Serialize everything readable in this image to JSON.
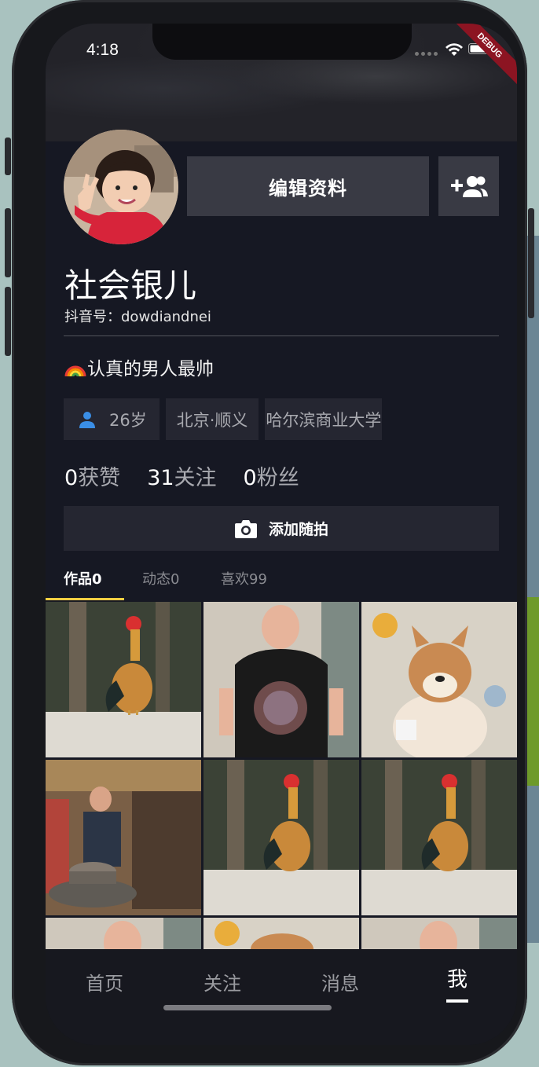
{
  "status_bar": {
    "time": "4:18",
    "debug_label": "DEBUG"
  },
  "profile": {
    "edit_button_label": "编辑资料",
    "nickname": "社会银儿",
    "douyin_id": "抖音号：dowdiandnei",
    "signature": "认真的男人最帅",
    "tags": {
      "age": "26岁",
      "location": "北京·顺义",
      "school": "哈尔滨商业大学"
    },
    "stats": [
      {
        "num": "0",
        "label": "获赞"
      },
      {
        "num": "31",
        "label": "关注"
      },
      {
        "num": "0",
        "label": "粉丝"
      }
    ],
    "add_photo_label": "添加随拍"
  },
  "tabs": [
    {
      "label": "作品0",
      "active": true
    },
    {
      "label": "动态0",
      "active": false
    },
    {
      "label": "喜欢99",
      "active": false
    }
  ],
  "bottom_nav": [
    {
      "label": "首页"
    },
    {
      "label": "关注"
    },
    {
      "label": "消息"
    },
    {
      "label": "我"
    }
  ],
  "icons": {
    "wifi": "wifi-icon",
    "battery": "battery-icon",
    "add_friend": "add-friend-icon",
    "person": "person-icon",
    "camera": "camera-icon",
    "rainbow": "rainbow-emoji"
  },
  "colors": {
    "background": "#161823",
    "accent": "#f8cf42",
    "age_icon": "#3a8ee6"
  }
}
